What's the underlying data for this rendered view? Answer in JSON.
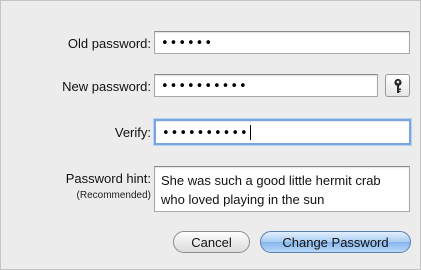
{
  "form": {
    "old_password": {
      "label": "Old password:",
      "masked_value": "••••••"
    },
    "new_password": {
      "label": "New password:",
      "masked_value": "••••••••••"
    },
    "verify": {
      "label": "Verify:",
      "masked_value": "••••••••••"
    },
    "hint": {
      "label": "Password hint:",
      "sublabel": "(Recommended)",
      "value": "She was such a good little hermit crab who loved playing in the sun"
    },
    "key_button_icon": "key-icon"
  },
  "buttons": {
    "cancel_label": "Cancel",
    "change_label": "Change Password"
  },
  "colors": {
    "focus_ring": "#7aa6df",
    "primary_button": "#a7cbf1"
  }
}
